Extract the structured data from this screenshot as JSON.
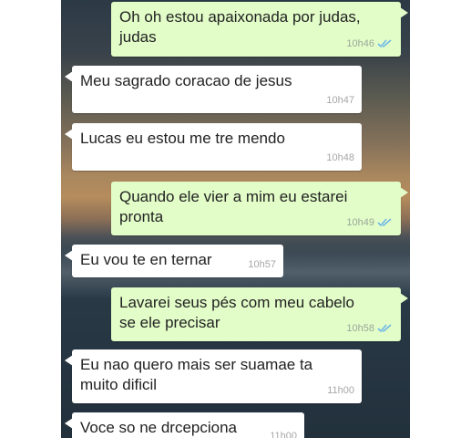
{
  "messages": [
    {
      "dir": "out",
      "text": "Oh oh estou apaixonada por judas,\njudas",
      "time": "10h46",
      "read_icon": "double-check-icon"
    },
    {
      "dir": "in",
      "text": "Meu sagrado coracao de jesus",
      "time": "10h47"
    },
    {
      "dir": "in",
      "text": "Lucas eu estou me tre mendo",
      "time": "10h48"
    },
    {
      "dir": "out",
      "text": "Quando ele vier a mim eu estarei\npronta",
      "time": "10h49",
      "read_icon": "double-check-icon"
    },
    {
      "dir": "in",
      "text": "Eu vou te en ternar",
      "time": "10h57"
    },
    {
      "dir": "out",
      "text": "Lavarei seus pés com meu cabelo\nse ele precisar",
      "time": "10h58",
      "read_icon": "double-check-icon"
    },
    {
      "dir": "in",
      "text": "Eu nao quero mais ser suamae ta\nmuito dificil",
      "time": "11h00"
    },
    {
      "dir": "in",
      "text": "Voce so ne drcepciona",
      "time": "11h00"
    }
  ],
  "colors": {
    "outgoing_bubble": "#e2fdc8",
    "incoming_bubble": "#ffffff",
    "read_ticks": "#6fb7e6"
  }
}
